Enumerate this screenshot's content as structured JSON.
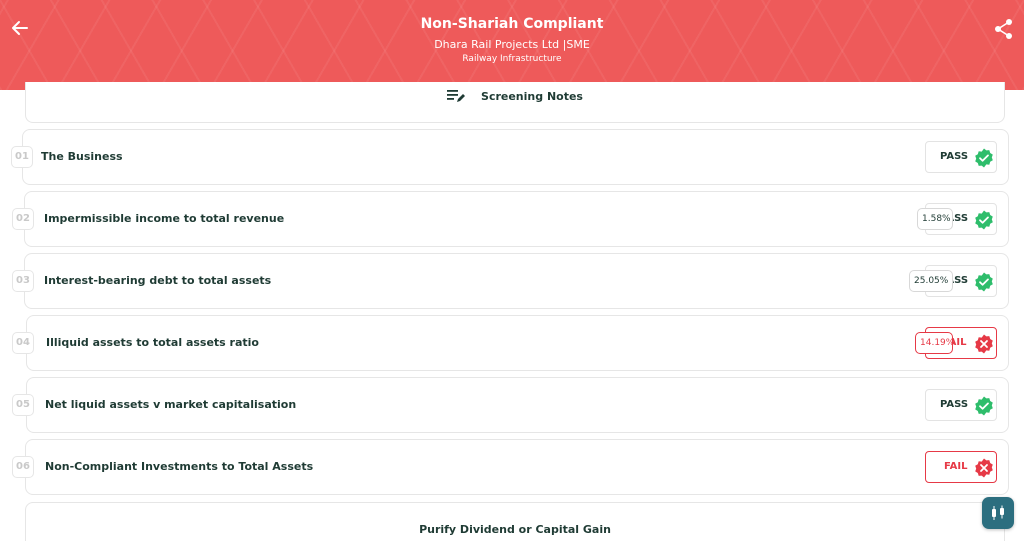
{
  "header": {
    "title": "Non-Shariah Compliant",
    "company": "Dhara Rail Projects Ltd |SME",
    "sector": "Railway Infrastructure",
    "back_icon": "arrow-left-icon",
    "share_icon": "share-icon"
  },
  "notes": {
    "label": "Screening Notes",
    "icon": "notes-edit-icon"
  },
  "criteria": [
    {
      "num": "01",
      "label": "The Business",
      "status": "PASS",
      "pct": ""
    },
    {
      "num": "02",
      "label": "Impermissible income to total revenue",
      "status": "PASS",
      "pct": "1.58%"
    },
    {
      "num": "03",
      "label": "Interest-bearing debt to total assets",
      "status": "PASS",
      "pct": "25.05%"
    },
    {
      "num": "04",
      "label": "Illiquid assets to total assets ratio",
      "status": "FAIL",
      "pct": "14.19%"
    },
    {
      "num": "05",
      "label": "Net liquid assets v market capitalisation",
      "status": "PASS",
      "pct": ""
    },
    {
      "num": "06",
      "label": "Non-Compliant Investments to Total Assets",
      "status": "FAIL",
      "pct": ""
    }
  ],
  "purify": {
    "label": "Purify Dividend or Capital Gain"
  },
  "colors": {
    "header": "#ee5a5a",
    "pass": "#2ebd6b",
    "fail": "#e63946",
    "fab": "#2c6e7f",
    "text": "#1f3b34"
  },
  "fab": {
    "icon": "candlestick-icon"
  }
}
